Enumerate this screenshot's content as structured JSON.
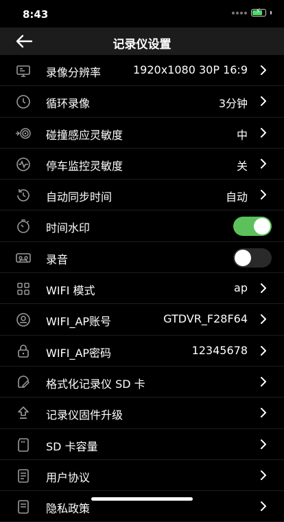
{
  "status_bar": {
    "time": "8:43"
  },
  "nav": {
    "title": "记录仪设置"
  },
  "settings": [
    {
      "id": "resolution",
      "icon": "video-resolution-icon",
      "label": "录像分辨率",
      "value": "1920x1080 30P 16:9",
      "control": "chevron"
    },
    {
      "id": "loop-record",
      "icon": "clock-icon",
      "label": "循环录像",
      "value": "3分钟",
      "control": "chevron"
    },
    {
      "id": "collision-sensitivity",
      "icon": "collision-sensor-icon",
      "label": "碰撞感应灵敏度",
      "value": "中",
      "control": "chevron"
    },
    {
      "id": "parking-monitor",
      "icon": "pulse-icon",
      "label": "停车监控灵敏度",
      "value": "关",
      "control": "chevron"
    },
    {
      "id": "auto-sync-time",
      "icon": "history-clock-icon",
      "label": "自动同步时间",
      "value": "自动",
      "control": "chevron"
    },
    {
      "id": "time-watermark",
      "icon": "stopwatch-icon",
      "label": "时间水印",
      "value": "",
      "control": "toggle",
      "on": true
    },
    {
      "id": "record-audio",
      "icon": "tape-icon",
      "label": "录音",
      "value": "",
      "control": "toggle",
      "on": false
    },
    {
      "id": "wifi-mode",
      "icon": "grid-icon",
      "label": "WIFI 模式",
      "value": "ap",
      "control": "chevron"
    },
    {
      "id": "wifi-ap-account",
      "icon": "user-circle-icon",
      "label": "WIFI_AP账号",
      "value": "GTDVR_F28F64",
      "control": "chevron"
    },
    {
      "id": "wifi-ap-password",
      "icon": "lock-icon",
      "label": "WIFI_AP密码",
      "value": "12345678",
      "control": "chevron"
    },
    {
      "id": "format-sd",
      "icon": "format-disk-icon",
      "label": "格式化记录仪 SD 卡",
      "value": "",
      "control": "chevron"
    },
    {
      "id": "firmware-upgrade",
      "icon": "upgrade-arrow-icon",
      "label": "记录仪固件升级",
      "value": "",
      "control": "chevron"
    },
    {
      "id": "sd-capacity",
      "icon": "sd-card-icon",
      "label": "SD 卡容量",
      "value": "",
      "control": "chevron"
    },
    {
      "id": "user-agreement",
      "icon": "document-icon",
      "label": "用户协议",
      "value": "",
      "control": "chevron"
    },
    {
      "id": "privacy-policy",
      "icon": "privacy-document-icon",
      "label": "隐私政策",
      "value": "",
      "control": "chevron"
    }
  ]
}
